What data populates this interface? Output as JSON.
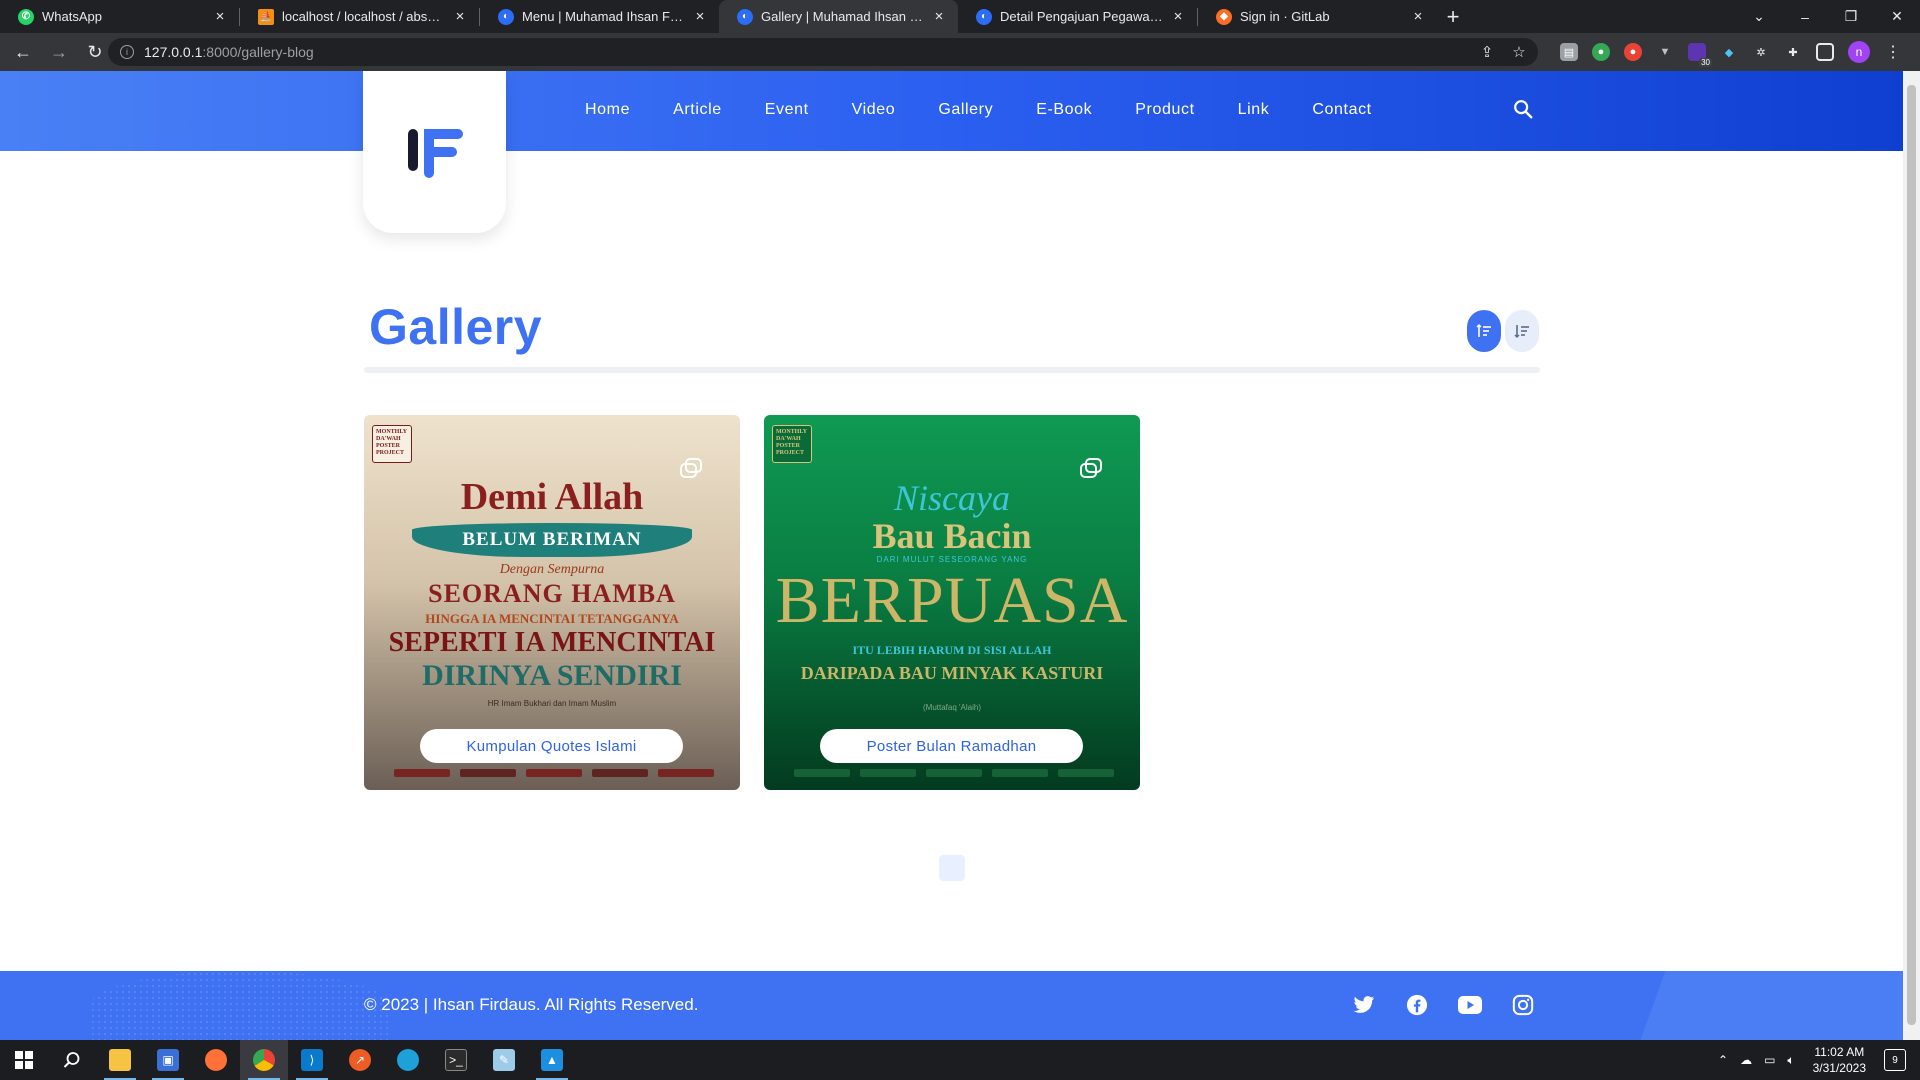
{
  "browser": {
    "tabs": [
      {
        "title": "WhatsApp",
        "favicon_color": "#25d366",
        "active": false
      },
      {
        "title": "localhost / localhost / absensi / p",
        "favicon_color": "#f29111",
        "active": false
      },
      {
        "title": "Menu | Muhamad Ihsan Firdaus",
        "favicon_color": "#2d6cf5",
        "active": false
      },
      {
        "title": "Gallery | Muhamad Ihsan Firdaus",
        "favicon_color": "#2d6cf5",
        "active": true
      },
      {
        "title": "Detail Pengajuan Pegawai - Base",
        "favicon_color": "#2d6cf5",
        "active": false
      },
      {
        "title": "Sign in · GitLab",
        "favicon_color": "#fc6d26",
        "active": false
      }
    ],
    "url_host": "127.0.0.1",
    "url_rest": ":8000/gallery-blog",
    "extension_badge": "30",
    "profile_initial": "n"
  },
  "site": {
    "nav": [
      "Home",
      "Article",
      "Event",
      "Video",
      "Gallery",
      "E-Book",
      "Product",
      "Link",
      "Contact"
    ],
    "page_title": "Gallery",
    "accent_color": "#3f72f2",
    "cards": [
      {
        "label": "Kumpulan Quotes Islami",
        "badge": "MONTHLY DA'WAH POSTER PROJECT",
        "poster_lines": [
          "Demi Allah",
          "BELUM BERIMAN",
          "Dengan Sempurna",
          "SEORANG HAMBA",
          "HINGGA IA MENCINTAI TETANGGANYA",
          "SEPERTI IA MENCINTAI",
          "DIRINYA SENDIRI"
        ],
        "poster_credit": "HR Imam Bukhari dan Imam Muslim"
      },
      {
        "label": "Poster Bulan Ramadhan",
        "badge": "MONTHLY DA'WAH POSTER PROJECT",
        "poster_lines": [
          "Niscaya",
          "Bau Bacin",
          "DARI MULUT SESEORANG YANG",
          "BERPUASA",
          "ITU LEBIH HARUM DI SISI ALLAH",
          "DARIPADA BAU MINYAK KASTURI"
        ],
        "poster_credit": "(Muttafaq 'Alaih)"
      }
    ],
    "footer_copyright": "© 2023 | Ihsan Firdaus. All Rights Reserved.",
    "social_icons": [
      "twitter-icon",
      "facebook-icon",
      "youtube-icon",
      "instagram-icon"
    ]
  },
  "taskbar": {
    "time": "11:02 AM",
    "date": "3/31/2023",
    "notification_count": "9"
  }
}
